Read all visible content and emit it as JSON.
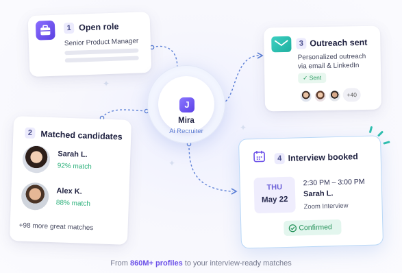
{
  "center": {
    "logo_letter": "J",
    "name": "Mira",
    "role": "Ai Recruiter"
  },
  "steps": {
    "open_role": {
      "number": "1",
      "title": "Open role",
      "role_name": "Senior Product Manager"
    },
    "matched": {
      "number": "2",
      "title": "Matched candidates",
      "candidates": [
        {
          "name": "Sarah L.",
          "match": "92% match"
        },
        {
          "name": "Alex K.",
          "match": "88% match"
        }
      ],
      "more": "+98 more great matches"
    },
    "outreach": {
      "number": "3",
      "title": "Outreach sent",
      "line1": "Personalized outreach",
      "line2": "via email & LinkedIn",
      "sent_label": "✓ Sent",
      "more_count": "+40"
    },
    "interview": {
      "number": "4",
      "title": "Interview booked",
      "day": "THU",
      "date": "May 22",
      "time": "2:30 PM – 3:00 PM",
      "candidate": "Sarah L.",
      "type": "Zoom Interview",
      "status": "Confirmed"
    }
  },
  "footer": {
    "prefix": "From ",
    "highlight": "860M+ profiles",
    "suffix": " to your interview-ready matches"
  },
  "colors": {
    "accent_purple": "#6a4fe8",
    "match_green": "#2bb07a",
    "connector": "#5b7fd6"
  }
}
